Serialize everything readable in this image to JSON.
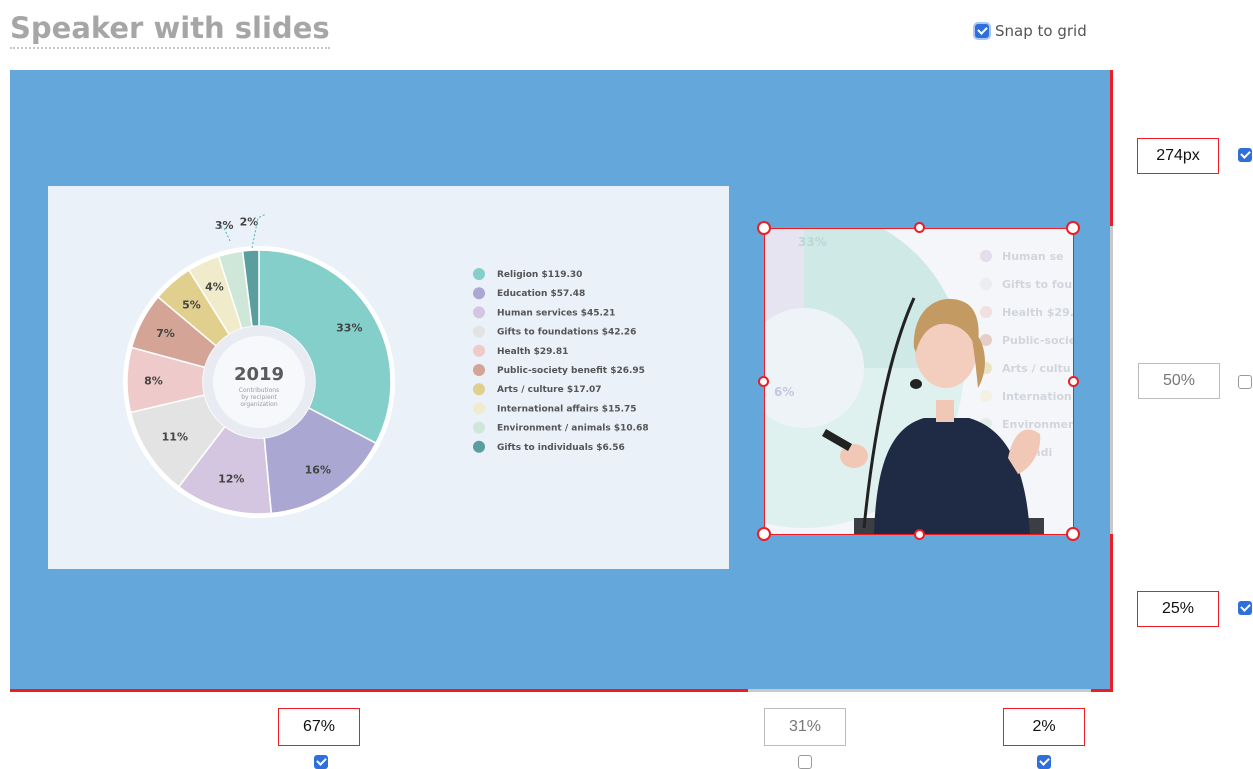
{
  "page": {
    "title": "Speaker with slides"
  },
  "snap": {
    "label": "Snap to grid",
    "checked": true
  },
  "slide": {
    "year": "2019",
    "center_text": [
      "Contributions",
      "by recipient",
      "organization"
    ],
    "percent_labels": [
      "2%",
      "3%",
      "4%",
      "5%",
      "7%",
      "8%",
      "11%",
      "12%",
      "16%",
      "33%"
    ]
  },
  "chart_data": {
    "type": "pie",
    "title": "2019",
    "categories": [
      "Religion",
      "Education",
      "Human services",
      "Gifts to foundations",
      "Health",
      "Public-society benefit",
      "Arts / culture",
      "International affairs",
      "Environment / animals",
      "Gifts to individuals"
    ],
    "values": [
      33,
      16,
      12,
      11,
      8,
      7,
      5,
      4,
      3,
      2
    ],
    "legend_labels": [
      "Religion $119.30",
      "Education $57.48",
      "Human services $45.21",
      "Gifts to foundations $42.26",
      "Health $29.81",
      "Public-society benefit $26.95",
      "Arts / culture $17.07",
      "International affairs $15.75",
      "Environment / animals $10.68",
      "Gifts to individuals $6.56"
    ],
    "colors": [
      "#84cfc9",
      "#aaa8d2",
      "#d4c6e0",
      "#e3e3e3",
      "#efcaca",
      "#d4a596",
      "#e1cf8d",
      "#efebcb",
      "#cfe7d8",
      "#5b9ea0"
    ],
    "legend_position": "right"
  },
  "photo": {
    "ghost_legend": [
      "Human se",
      "Gifts to fou",
      "Health $29.",
      "Public-socie",
      "Arts / cultu",
      "Internation",
      "Environmen",
      "s to indi"
    ],
    "ghost_pcts": [
      "33%",
      "6%"
    ]
  },
  "controls": {
    "right": [
      {
        "value": "274px",
        "checked": true
      },
      {
        "value": "50%",
        "checked": false
      },
      {
        "value": "25%",
        "checked": true
      }
    ],
    "bottom": [
      {
        "value": "67%",
        "checked": true
      },
      {
        "value": "31%",
        "checked": false
      },
      {
        "value": "2%",
        "checked": true
      }
    ]
  },
  "colors": {
    "stage": "#63a7db",
    "accent": "#ee1c24",
    "checkbox": "#2f6fdc"
  }
}
